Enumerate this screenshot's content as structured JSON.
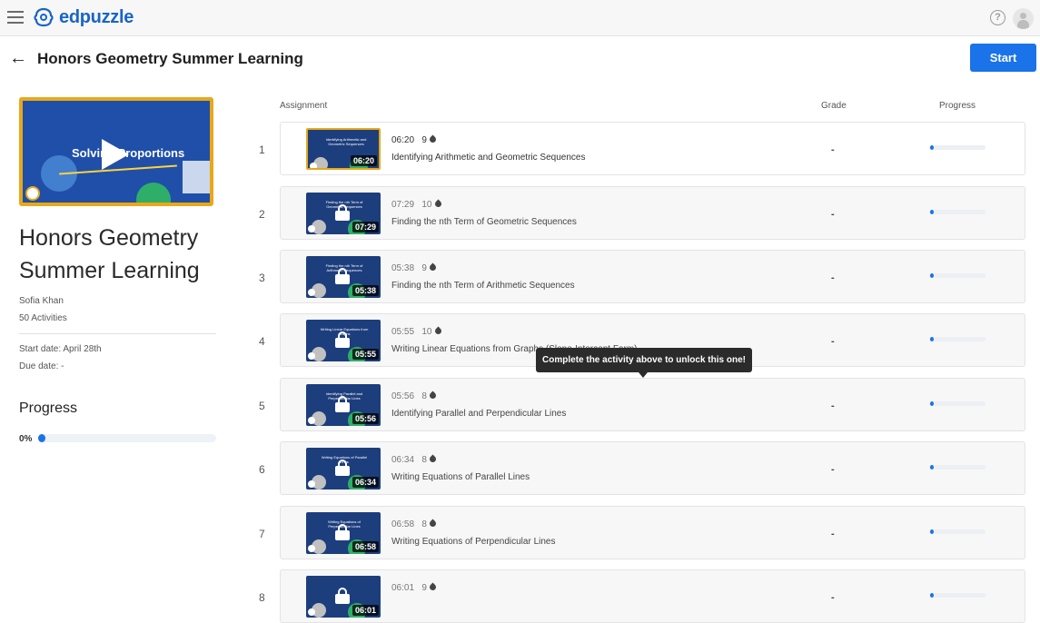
{
  "topbar": {
    "logo_text": "edpuzzle",
    "icons": [
      "hamburger-menu-icon",
      "edpuzzle-logo-icon",
      "help-icon",
      "avatar-icon"
    ],
    "help_glyph": "?"
  },
  "header": {
    "title": "Honors Geometry Summer Learning",
    "start_label": "Start"
  },
  "course": {
    "cover_text": "Solving Proportions",
    "title": "Honors Geometry Summer Learning",
    "author": "Sofia Khan",
    "activities": "50 Activities",
    "start_date": "Start date: April 28th",
    "due_date": "Due date: -",
    "progress_heading": "Progress",
    "progress_pct": "0%",
    "progress_fraction": 0
  },
  "table": {
    "headers": {
      "assignment": "Assignment",
      "grade": "Grade",
      "progress": "Progress"
    },
    "rows": [
      {
        "num": "1",
        "duration": "06:20",
        "points": "9",
        "title": "Identifying Arithmetic and Geometric Sequences",
        "thumb_text": "Identifying Arithmetic and Geometric Sequences",
        "grade": "-",
        "locked": false,
        "progress_fraction": 0
      },
      {
        "num": "2",
        "duration": "07:29",
        "points": "10",
        "title": "Finding the nth Term of Geometric Sequences",
        "thumb_text": "Finding the nth Term of Geometric Sequences",
        "grade": "-",
        "locked": true,
        "progress_fraction": 0
      },
      {
        "num": "3",
        "duration": "05:38",
        "points": "9",
        "title": "Finding the nth Term of Arithmetic Sequences",
        "thumb_text": "Finding the nth Term of Arithmetic Sequences",
        "grade": "-",
        "locked": true,
        "progress_fraction": 0
      },
      {
        "num": "4",
        "duration": "05:55",
        "points": "10",
        "title": "Writing Linear Equations from Graphs (Slope-Intercept Form)",
        "thumb_text": "Writing Linear Equations from Graphs",
        "grade": "-",
        "locked": true,
        "progress_fraction": 0
      },
      {
        "num": "5",
        "duration": "05:56",
        "points": "8",
        "title": "Identifying Parallel and Perpendicular Lines",
        "thumb_text": "Identifying Parallel and Perpendicular Lines",
        "grade": "-",
        "locked": true,
        "progress_fraction": 0
      },
      {
        "num": "6",
        "duration": "06:34",
        "points": "8",
        "title": "Writing Equations of Parallel Lines",
        "thumb_text": "Writing Equations of Parallel Lines",
        "grade": "-",
        "locked": true,
        "progress_fraction": 0
      },
      {
        "num": "7",
        "duration": "06:58",
        "points": "8",
        "title": "Writing Equations of Perpendicular Lines",
        "thumb_text": "Writing Equations of Perpendicular Lines",
        "grade": "-",
        "locked": true,
        "progress_fraction": 0
      },
      {
        "num": "8",
        "duration": "06:01",
        "points": "9",
        "title": "",
        "thumb_text": "",
        "grade": "-",
        "locked": true,
        "progress_fraction": 0
      }
    ]
  },
  "tooltip": {
    "text": "Complete the activity above to unlock this one!"
  },
  "colors": {
    "accent": "#1a73e8",
    "brand": "#1a64c8",
    "cover_border": "#e8a81a"
  }
}
